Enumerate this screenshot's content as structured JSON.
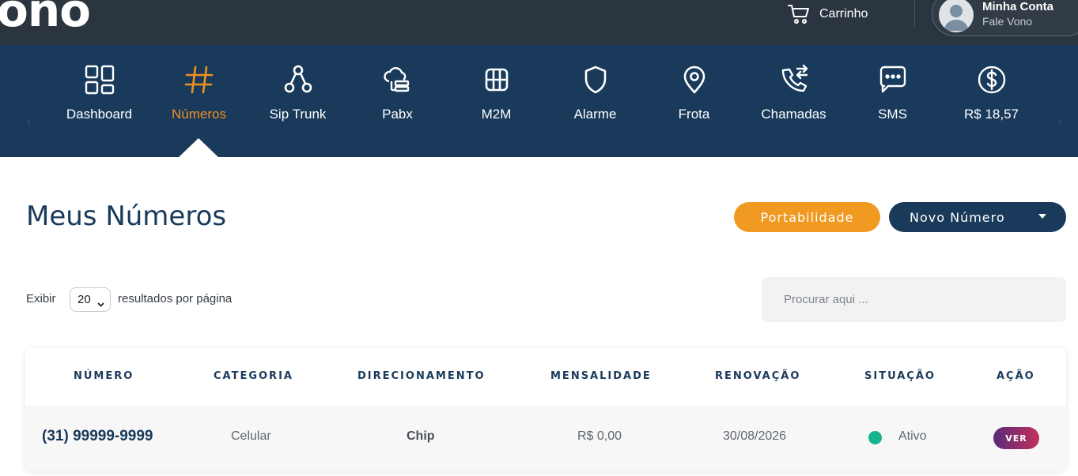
{
  "brand": {
    "logo_text": "ono"
  },
  "topbar": {
    "cart_label": "Carrinho",
    "account_title": "Minha Conta",
    "account_subtitle": "Fale Vono"
  },
  "nav": {
    "items": [
      {
        "label": "Dashboard",
        "icon": "dashboard-icon"
      },
      {
        "label": "Números",
        "icon": "hash-icon",
        "active": true
      },
      {
        "label": "Sip Trunk",
        "icon": "sip-trunk-icon"
      },
      {
        "label": "Pabx",
        "icon": "pabx-icon"
      },
      {
        "label": "M2M",
        "icon": "m2m-icon"
      },
      {
        "label": "Alarme",
        "icon": "shield-icon"
      },
      {
        "label": "Frota",
        "icon": "map-pin-icon"
      },
      {
        "label": "Chamadas",
        "icon": "phone-calls-icon"
      },
      {
        "label": "SMS",
        "icon": "sms-icon"
      },
      {
        "label": "R$ 18,57",
        "icon": "dollar-icon"
      }
    ],
    "prev_arrow": "‹",
    "next_arrow": "›"
  },
  "page": {
    "title": "Meus Números",
    "btn_portabilidade": "Portabilidade",
    "btn_novo_numero": "Novo Número"
  },
  "controls": {
    "exibir_label": "Exibir",
    "per_page_value": "20",
    "resultados_label": "resultados por página",
    "search_placeholder": "Procurar aqui ..."
  },
  "table": {
    "headers": [
      "NÚMERO",
      "CATEGORIA",
      "DIRECIONAMENTO",
      "MENSALIDADE",
      "RENOVAÇÃO",
      "SITUAÇÃO",
      "AÇÃO"
    ],
    "rows": [
      {
        "numero": "(31) 99999-9999",
        "categoria": "Celular",
        "direcionamento": "Chip",
        "mensalidade": "R$ 0,00",
        "renovacao": "30/08/2026",
        "situacao": "Ativo",
        "acao": "VER"
      }
    ]
  },
  "colors": {
    "topbar": "#2b3540",
    "nav": "#193a5b",
    "accent_orange": "#f09a22",
    "primary": "#193a5b",
    "status_active": "#17b38f"
  }
}
